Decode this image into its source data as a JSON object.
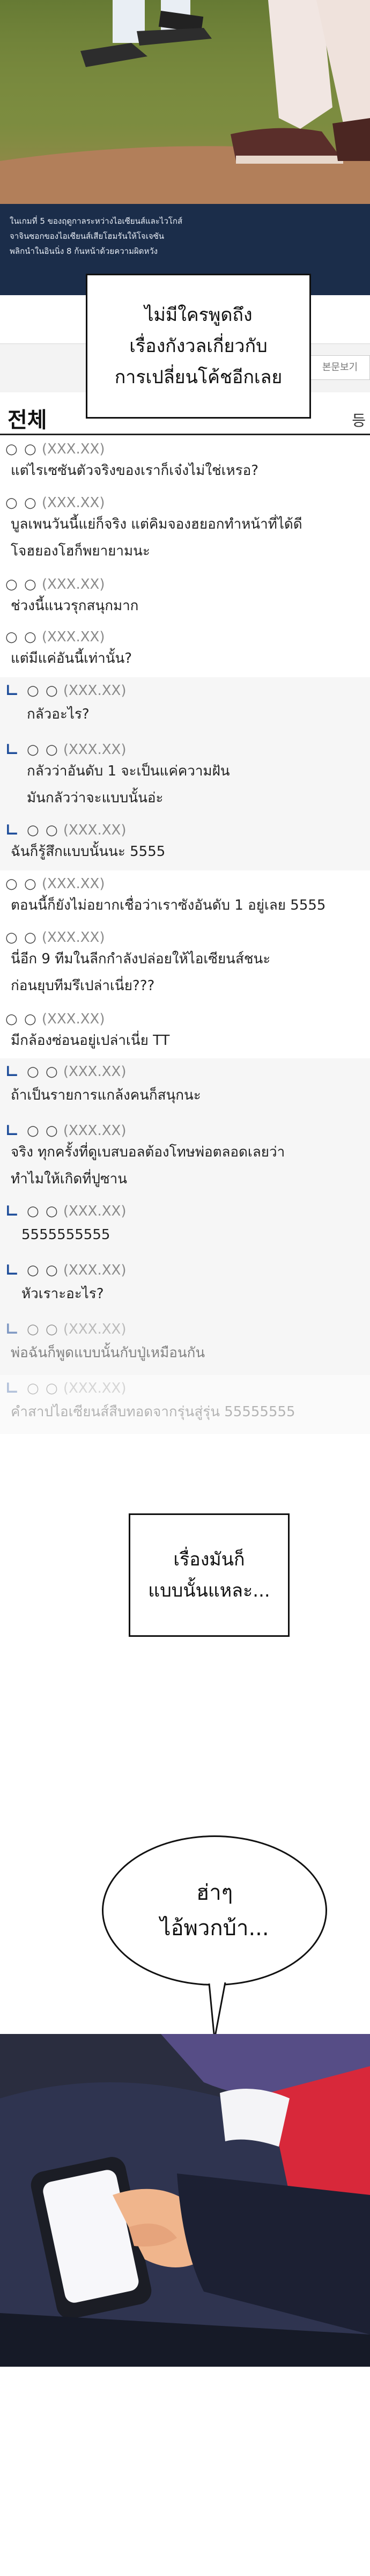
{
  "caption": {
    "lines": [
      "ในเกมที่ 5 ของฤดูกาลระหว่างไอเซียนส์และไวโกส์",
      "จาจินซอกของไอเซียนส์เสียโฮมรันให้โจเจซัน",
      "พลิกนำในอินนิ่ง 8 ก้นหน้าด้วยความผิดหวัง"
    ]
  },
  "board": {
    "tab_more_label": "본문보기",
    "all_label": "전체",
    "all_right": "등"
  },
  "top_speech": "ไม่มีใครพูดถึง\nเรื่องกังวลเกี่ยวกับ\nการเปลี่ยนโค้ชอีกเลย",
  "comments": [
    {
      "dots": "○ ○",
      "id": "(XXX.XX)",
      "text": "แต่ไรเซซันตัวจริงของเราก็เจ๋งไม่ใช่เหรอ?"
    },
    {
      "dots": "○ ○",
      "id": "(XXX.XX)",
      "text": "บูลเพนวันนี้แย่ก็จริง แต่คิมจองฮยอกทำหน้าที่ได้ดี\nโจฮยองโฮก็พยายามนะ"
    },
    {
      "dots": "○ ○",
      "id": "(XXX.XX)",
      "text": "ช่วงนี้แนวรุกสนุกมาก"
    },
    {
      "dots": "○ ○",
      "id": "(XXX.XX)",
      "text": "แต่มีแค่อันนี้เท่านั้น?"
    },
    {
      "dots": "○ ○",
      "id": "(XXX.XX)",
      "text": "กลัวอะไร?"
    },
    {
      "dots": "○ ○",
      "id": "(XXX.XX)",
      "text": "กลัวว่าอันดับ 1 จะเป็นแค่ความฝัน\nมันกลัวว่าจะแบบนั้นอ่ะ"
    },
    {
      "dots": "○ ○",
      "id": "(XXX.XX)",
      "text": "ฉันก็รู้สึกแบบนั้นนะ 5555"
    },
    {
      "dots": "○ ○",
      "id": "(XXX.XX)",
      "text": "ตอนนี้ก็ยังไม่อยากเชื่อว่าเราซังอันดับ 1 อยู่เลย 5555"
    },
    {
      "dots": "○ ○",
      "id": "(XXX.XX)",
      "text": "นี่อีก 9 ทีมในลีกกำลังปล่อยให้ไอเซียนส์ชนะ\nก่อนยุบทีมรึเปล่าเนี่ย???"
    },
    {
      "dots": "○ ○",
      "id": "(XXX.XX)",
      "text": "มีกล้องซ่อนอยู่เปล่าเนี่ย TT"
    },
    {
      "dots": "○ ○",
      "id": "(XXX.XX)",
      "text": "ถ้าเป็นรายการแกล้งคนก็สนุกนะ"
    },
    {
      "dots": "○ ○",
      "id": "(XXX.XX)",
      "text": "จริง ทุกครั้งที่ดูเบสบอลต้องโทษพ่อตลอดเลยว่า\nทำไมให้เกิดที่ปูซาน"
    },
    {
      "dots": "○ ○",
      "id": "(XXX.XX)",
      "text": "5555555555"
    },
    {
      "dots": "○ ○",
      "id": "(XXX.XX)",
      "text": "หัวเราะอะไร?"
    },
    {
      "dots": "○ ○",
      "id": "(XXX.XX)",
      "text": "พ่อฉันก็พูดแบบนั้นกับปู่เหมือนกัน"
    },
    {
      "dots": "○ ○",
      "id": "(XXX.XX)",
      "text": "คำสาปไอเซียนส์สืบทอดจากรุ่นสู่รุ่น 55555555"
    }
  ],
  "middle_speech": "เรื่องมันก็\nแบบนั้นแหละ...",
  "balloon_text": "ฮ่าๆ\nไอ้พวกบ้า...",
  "colors": {
    "caption_bg": "#1b2d4a",
    "reply_marker": "#1e4d9a"
  }
}
